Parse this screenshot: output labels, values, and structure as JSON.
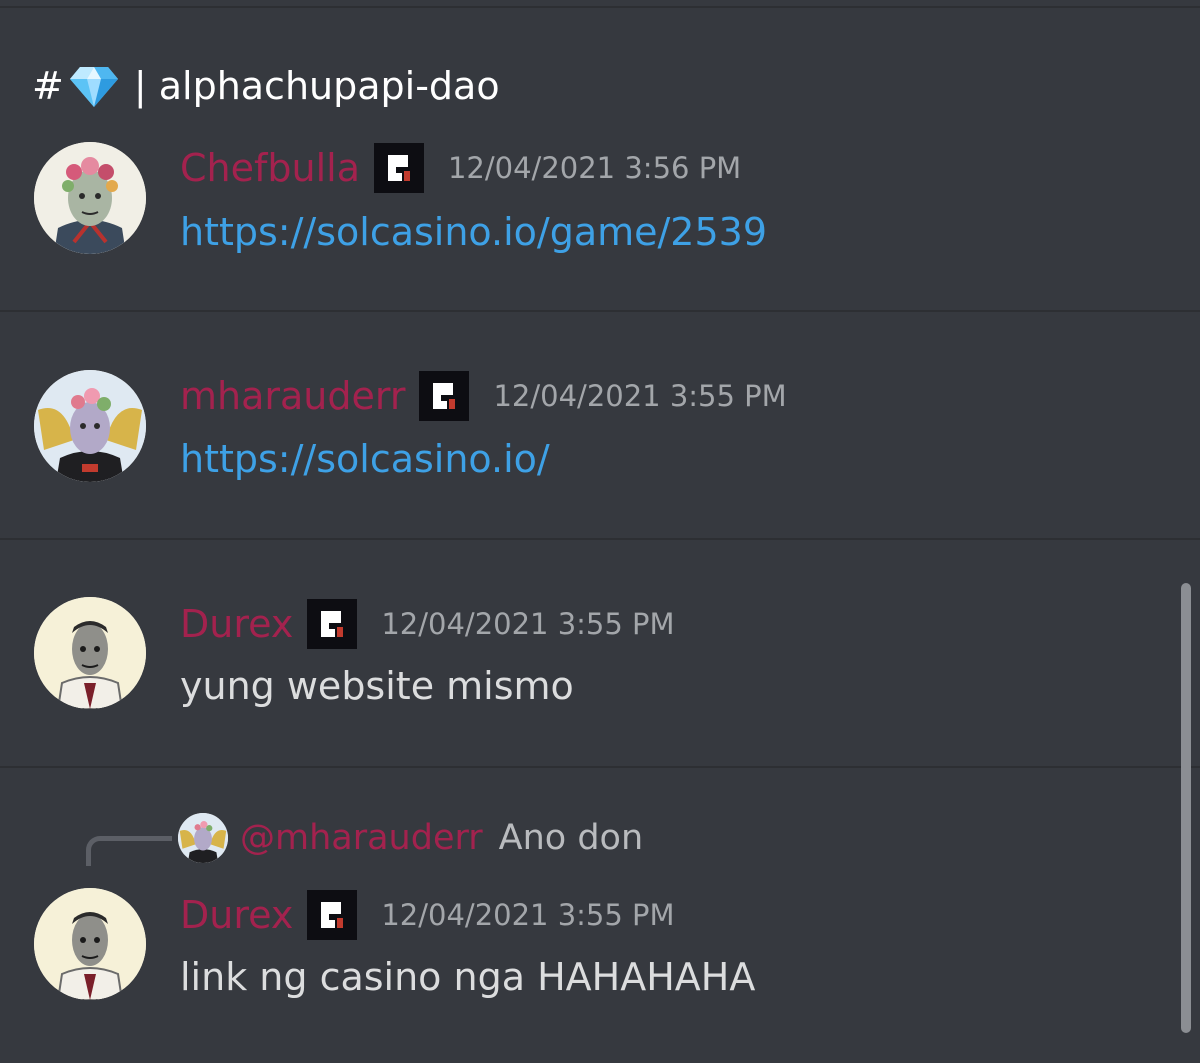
{
  "channel": {
    "hash": "#",
    "icon": "gem-icon",
    "name": "| alphachupapi-dao"
  },
  "messages": [
    {
      "username": "Chefbulla",
      "timestamp": "12/04/2021 3:56 PM",
      "body": "https://solcasino.io/game/2539",
      "type": "link"
    },
    {
      "username": "mharauderr",
      "timestamp": "12/04/2021 3:55 PM",
      "body": "https://solcasino.io/",
      "type": "link"
    },
    {
      "username": "Durex",
      "timestamp": "12/04/2021 3:55 PM",
      "body": "yung website mismo",
      "type": "text"
    },
    {
      "username": "Durex",
      "timestamp": "12/04/2021 3:55 PM",
      "body": "link ng casino nga HAHAHAHA",
      "type": "text",
      "reply": {
        "mention": "@mharauderr",
        "preview": "Ano don"
      }
    }
  ],
  "colors": {
    "background": "#36393f",
    "username": "#a3224e",
    "link": "#3ea1e6",
    "timestamp": "#a3a6aa"
  }
}
